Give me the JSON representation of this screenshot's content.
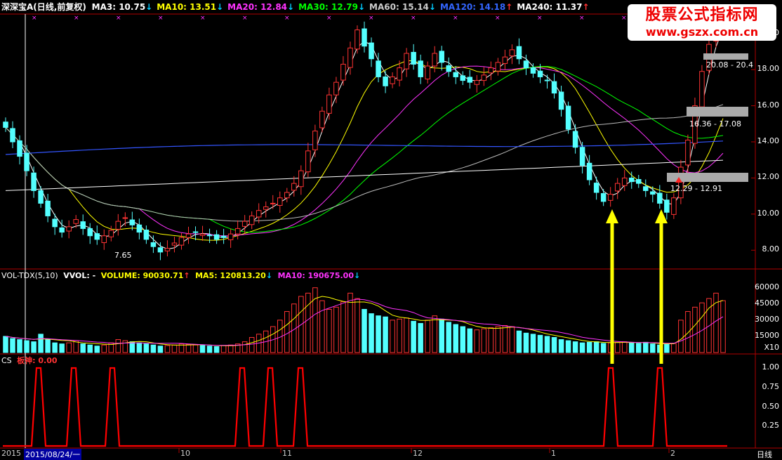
{
  "header": {
    "stock": "深深宝A(日线,前复权)",
    "ma": [
      {
        "label": "MA3: 10.75",
        "arrow": "↓",
        "color": "#ffffff",
        "arrowColor": "#00ccff"
      },
      {
        "label": "MA10: 13.51",
        "arrow": "↓",
        "color": "#ffff00",
        "arrowColor": "#00ccff"
      },
      {
        "label": "MA20: 12.84",
        "arrow": "↓",
        "color": "#ff33ff",
        "arrowColor": "#00ccff"
      },
      {
        "label": "MA30: 12.79",
        "arrow": "↓",
        "color": "#00ff00",
        "arrowColor": "#00ccff"
      },
      {
        "label": "MA60: 15.14",
        "arrow": "↓",
        "color": "#cccccc",
        "arrowColor": "#00ccff"
      },
      {
        "label": "MA120: 14.18",
        "arrow": "↑",
        "color": "#3366ff",
        "arrowColor": "#ff3333"
      },
      {
        "label": "MA240: 11.37",
        "arrow": "↑",
        "color": "#ffffff",
        "arrowColor": "#ff3333"
      }
    ]
  },
  "volHeader": {
    "name": "VOL-TDX(5,10)",
    "vvol": "VVOL: -",
    "volume": "VOLUME: 90030.71",
    "volumeArrow": "↑",
    "ma5": "MA5: 120813.20",
    "ma5Arrow": "↓",
    "ma10": "MA10: 190675.00",
    "ma10Arrow": "↓"
  },
  "csHeader": {
    "name": "CS",
    "value": "板神: 0.00"
  },
  "watermark": {
    "line1": "股票公式指标网",
    "line2": "www.gszx.com.cn"
  },
  "priceAxis": [
    "20.00",
    "18.00",
    "16.00",
    "14.00",
    "12.00",
    "10.00",
    "8.00"
  ],
  "volAxis": [
    "60000",
    "45000",
    "30000",
    "15000"
  ],
  "volUnit": "X10",
  "csAxis": [
    "1.00",
    "0.75",
    "0.50",
    "0.25"
  ],
  "xAxis": {
    "year": "2015",
    "cursor": "2015/08/24/一",
    "months": [
      "10",
      "11",
      "12",
      "1",
      "2"
    ],
    "period": "日线"
  },
  "annotations": {
    "lowPrice": "7.65",
    "zone1": "20.08 - 20.4",
    "zone2": "16.36 - 17.08",
    "zone3": "12.29 - 12.91"
  },
  "colors": {
    "up": "#ff3333",
    "down": "#54ffff",
    "signal": "#ff0000",
    "arrow": "#ffff00"
  },
  "chart_data": {
    "type": "candlestick",
    "ylim": [
      7,
      21
    ],
    "closes": [
      14.8,
      14.0,
      13.2,
      12.4,
      11.3,
      10.6,
      9.9,
      9.3,
      9.0,
      9.3,
      9.7,
      9.2,
      8.8,
      8.6,
      8.8,
      9.1,
      9.6,
      9.8,
      9.4,
      9.0,
      8.6,
      8.2,
      7.9,
      8.1,
      8.4,
      8.7,
      8.9,
      9.0,
      8.9,
      8.8,
      8.6,
      8.7,
      8.9,
      9.2,
      9.6,
      9.9,
      10.2,
      10.4,
      10.6,
      10.9,
      11.2,
      11.7,
      12.4,
      13.5,
      14.6,
      15.7,
      16.6,
      17.3,
      18.3,
      19.2,
      20.2,
      19.3,
      18.6,
      17.6,
      17.1,
      17.6,
      18.1,
      18.9,
      18.3,
      17.6,
      18.2,
      18.9,
      18.4,
      17.9,
      17.6,
      17.4,
      17.3,
      17.4,
      17.7,
      18.1,
      18.4,
      18.7,
      19.1,
      18.6,
      18.1,
      17.8,
      17.6,
      17.4,
      16.7,
      15.8,
      14.7,
      13.7,
      12.7,
      11.9,
      11.2,
      10.7,
      11.1,
      11.7,
      12.0,
      11.8,
      11.7,
      11.3,
      11.1,
      10.6,
      10.1,
      10.9,
      12.6,
      14.1,
      16.0,
      17.9,
      19.4,
      20.5,
      20.9
    ],
    "volumes": [
      15000,
      13000,
      12000,
      11000,
      10000,
      17000,
      12000,
      9000,
      8000,
      9000,
      11000,
      8000,
      7000,
      6000,
      7000,
      9000,
      12000,
      11000,
      10000,
      9000,
      8000,
      7000,
      6000,
      6500,
      7000,
      8000,
      7500,
      7000,
      6500,
      6000,
      5500,
      6500,
      7000,
      8000,
      10000,
      14000,
      17000,
      20000,
      24000,
      30000,
      38000,
      45000,
      52000,
      55000,
      60000,
      48000,
      40000,
      42000,
      47000,
      55000,
      50000,
      40000,
      36000,
      34000,
      33000,
      30000,
      31000,
      32000,
      29000,
      27000,
      30000,
      34000,
      31000,
      28000,
      26000,
      24000,
      22000,
      21000,
      22000,
      23000,
      24000,
      25000,
      24000,
      20000,
      18000,
      17000,
      16000,
      15000,
      14000,
      12000,
      11000,
      10000,
      9000,
      9500,
      10000,
      8500,
      9000,
      9500,
      10000,
      9000,
      8500,
      9500,
      8000,
      7000,
      7500,
      8500,
      30000,
      38000,
      42000,
      46000,
      50000,
      55000,
      48000
    ],
    "signals": [
      [
        55,
        1
      ],
      [
        105,
        1
      ],
      [
        160,
        1
      ],
      [
        345,
        1
      ],
      [
        385,
        1
      ],
      [
        428,
        1
      ],
      [
        870,
        1
      ],
      [
        940,
        1
      ]
    ]
  }
}
